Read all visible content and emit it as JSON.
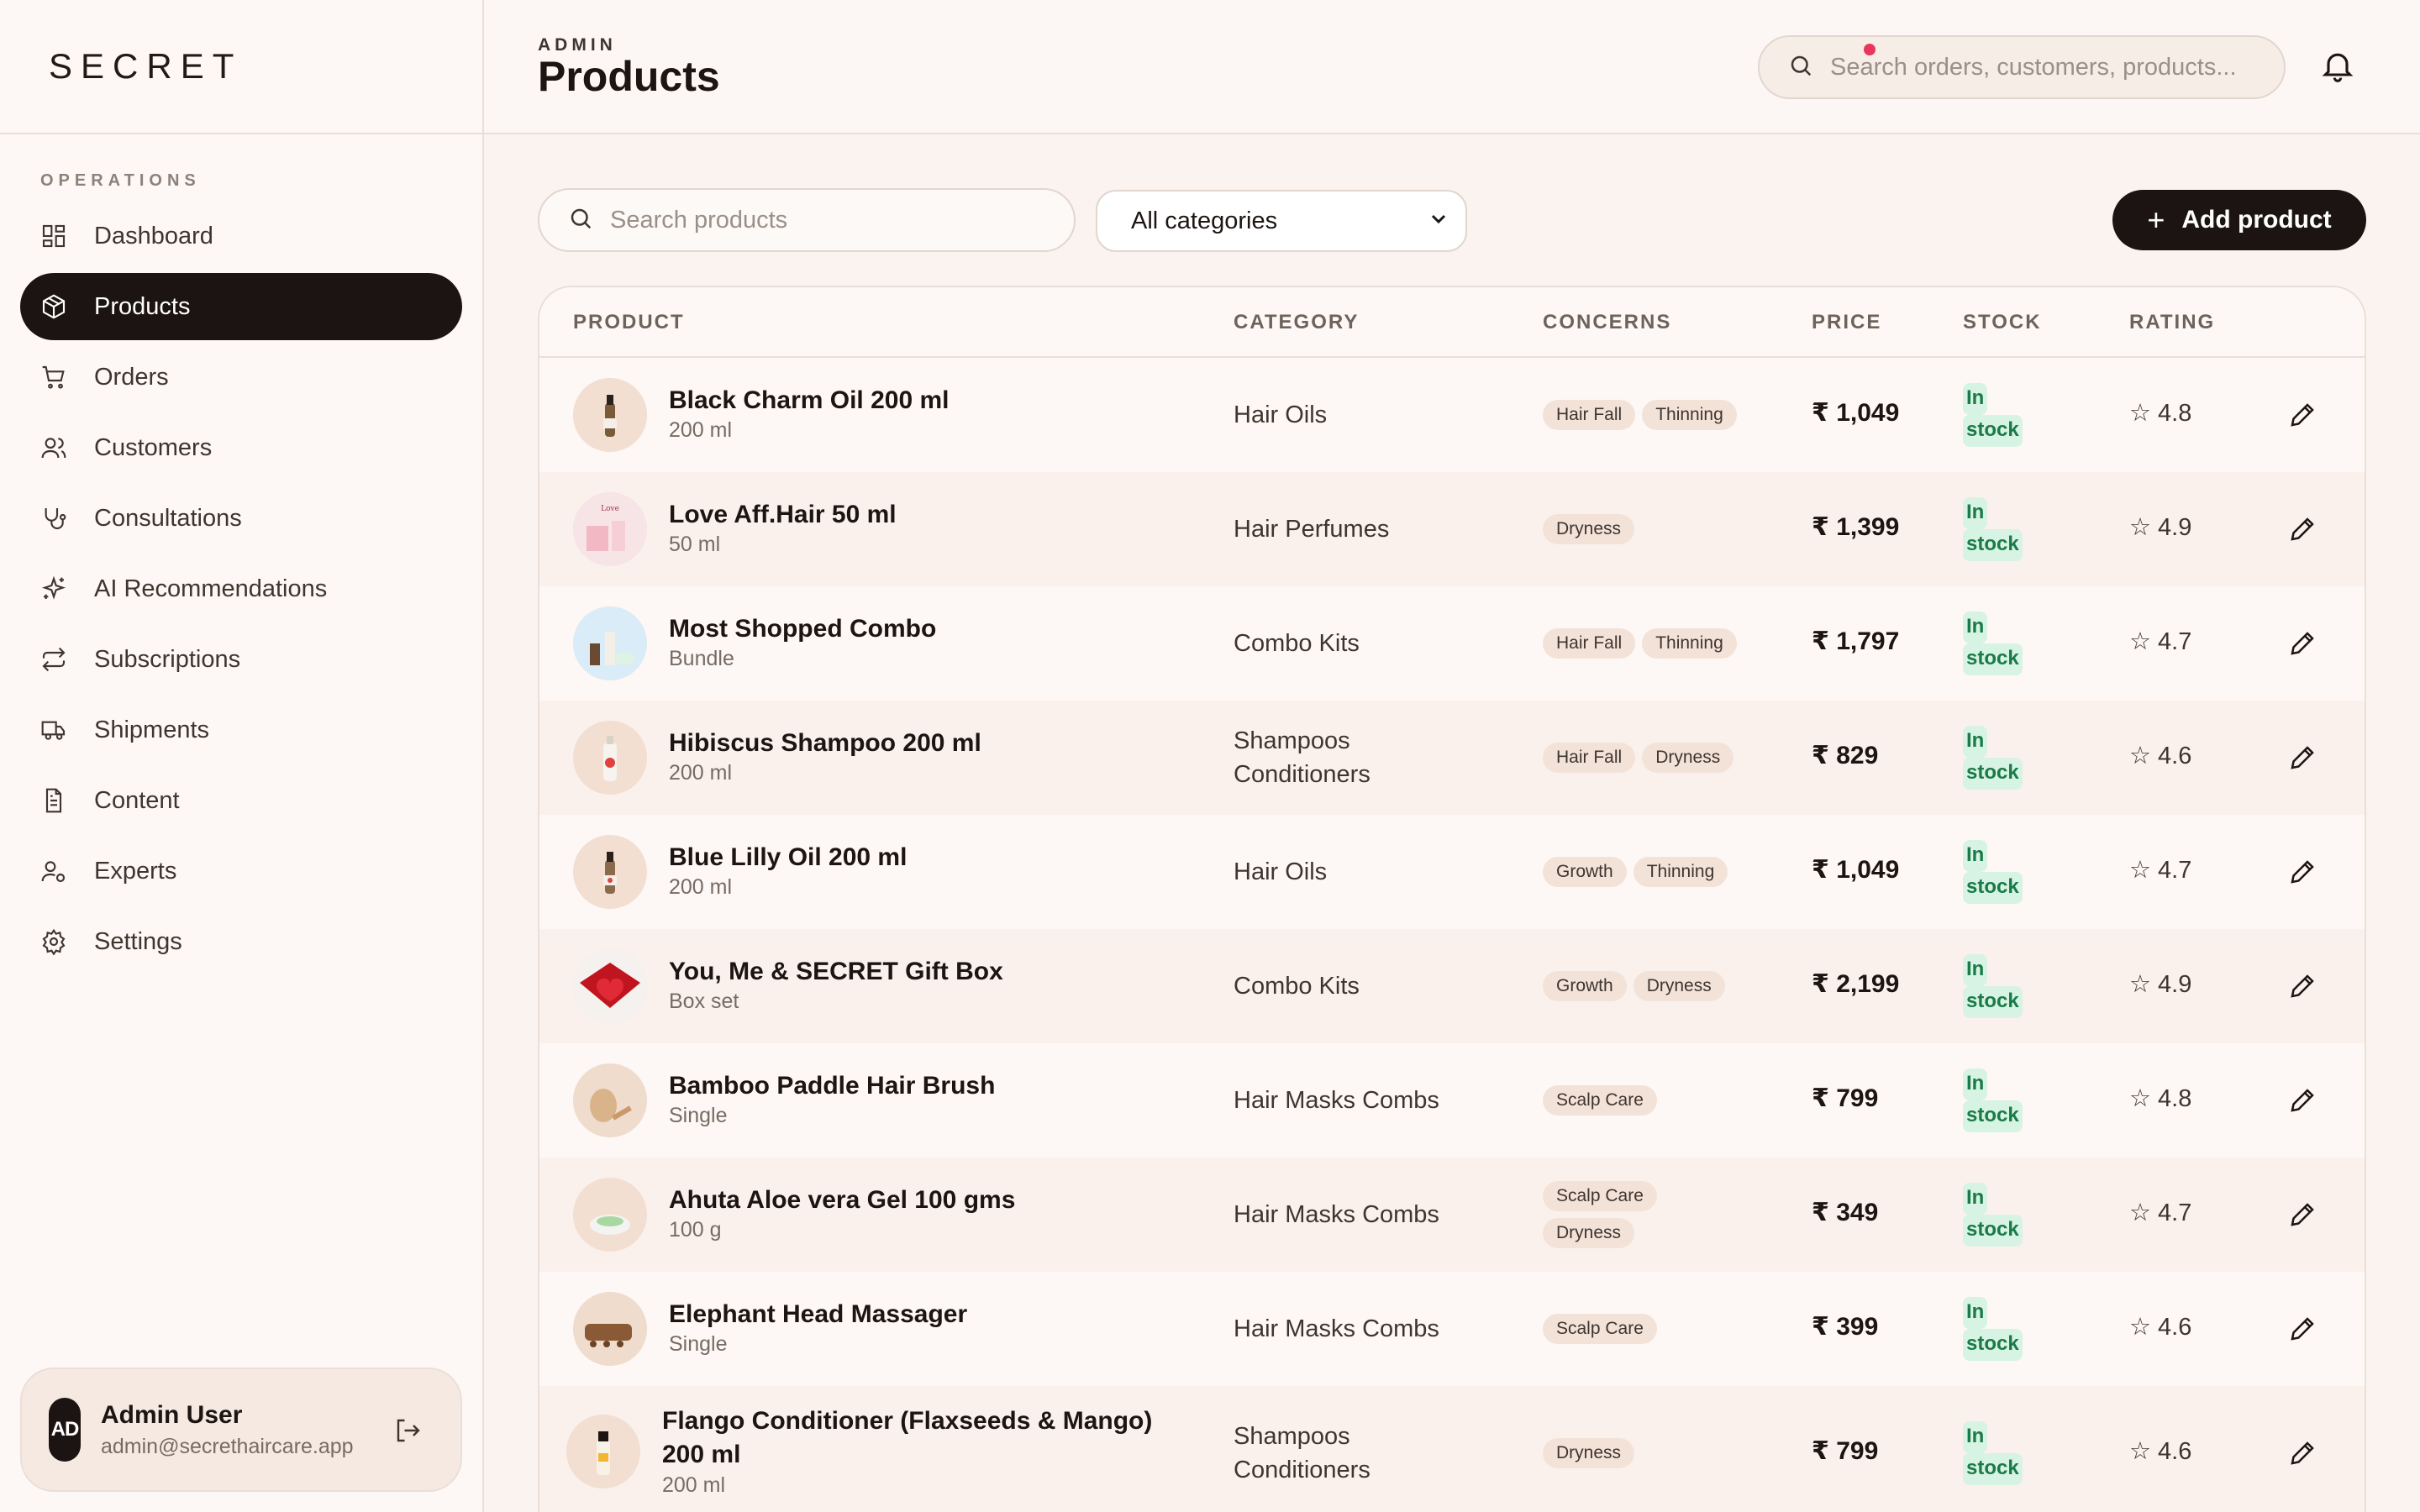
{
  "brand": "SECRET",
  "sidebar": {
    "section_label": "OPERATIONS",
    "items": [
      {
        "label": "Dashboard",
        "icon": "dashboard-icon"
      },
      {
        "label": "Products",
        "icon": "package-icon",
        "active": true
      },
      {
        "label": "Orders",
        "icon": "cart-icon"
      },
      {
        "label": "Customers",
        "icon": "users-icon"
      },
      {
        "label": "Consultations",
        "icon": "stethoscope-icon"
      },
      {
        "label": "AI Recommendations",
        "icon": "sparkles-icon"
      },
      {
        "label": "Subscriptions",
        "icon": "repeat-icon"
      },
      {
        "label": "Shipments",
        "icon": "truck-icon"
      },
      {
        "label": "Content",
        "icon": "file-icon"
      },
      {
        "label": "Experts",
        "icon": "user-cog-icon"
      },
      {
        "label": "Settings",
        "icon": "gear-icon"
      }
    ],
    "user": {
      "initials": "AD",
      "name": "Admin User",
      "email": "admin@secrethaircare.app"
    }
  },
  "header": {
    "eyebrow": "ADMIN",
    "title": "Products",
    "search_placeholder": "Search orders, customers, products..."
  },
  "toolbar": {
    "search_placeholder": "Search products",
    "category_value": "All categories",
    "add_label": "Add product"
  },
  "table": {
    "columns": [
      "PRODUCT",
      "CATEGORY",
      "CONCERNS",
      "PRICE",
      "STOCK",
      "RATING"
    ],
    "rows": [
      {
        "name": "Black Charm Oil 200 ml",
        "sub": "200 ml",
        "category": [
          "Hair Oils"
        ],
        "concerns": [
          "Hair Fall",
          "Thinning"
        ],
        "price": "₹ 1,049",
        "stock": [
          "In",
          "stock"
        ],
        "rating": "☆ 4.8"
      },
      {
        "name": "Love Aff.Hair 50 ml",
        "sub": "50 ml",
        "category": [
          "Hair Perfumes"
        ],
        "concerns": [
          "Dryness"
        ],
        "price": "₹ 1,399",
        "stock": [
          "In",
          "stock"
        ],
        "rating": "☆ 4.9"
      },
      {
        "name": "Most Shopped Combo",
        "sub": "Bundle",
        "category": [
          "Combo Kits"
        ],
        "concerns": [
          "Hair Fall",
          "Thinning"
        ],
        "price": "₹ 1,797",
        "stock": [
          "In",
          "stock"
        ],
        "rating": "☆ 4.7"
      },
      {
        "name": "Hibiscus Shampoo 200 ml",
        "sub": "200 ml",
        "category": [
          "Shampoos",
          "Conditioners"
        ],
        "concerns": [
          "Hair Fall",
          "Dryness"
        ],
        "price": "₹ 829",
        "stock": [
          "In",
          "stock"
        ],
        "rating": "☆ 4.6"
      },
      {
        "name": "Blue Lilly Oil 200 ml",
        "sub": "200 ml",
        "category": [
          "Hair Oils"
        ],
        "concerns": [
          "Growth",
          "Thinning"
        ],
        "price": "₹ 1,049",
        "stock": [
          "In",
          "stock"
        ],
        "rating": "☆ 4.7"
      },
      {
        "name": "You, Me & SECRET Gift Box",
        "sub": "Box set",
        "category": [
          "Combo Kits"
        ],
        "concerns": [
          "Growth",
          "Dryness"
        ],
        "price": "₹ 2,199",
        "stock": [
          "In",
          "stock"
        ],
        "rating": "☆ 4.9"
      },
      {
        "name": "Bamboo Paddle Hair Brush",
        "sub": "Single",
        "category": [
          "Hair Masks Combs"
        ],
        "concerns": [
          "Scalp Care"
        ],
        "price": "₹ 799",
        "stock": [
          "In",
          "stock"
        ],
        "rating": "☆ 4.8"
      },
      {
        "name": "Ahuta Aloe vera Gel 100 gms",
        "sub": "100 g",
        "category": [
          "Hair Masks Combs"
        ],
        "concerns": [
          "Scalp Care",
          "Dryness"
        ],
        "price": "₹ 349",
        "stock": [
          "In",
          "stock"
        ],
        "rating": "☆ 4.7"
      },
      {
        "name": "Elephant Head Massager",
        "sub": "Single",
        "category": [
          "Hair Masks Combs"
        ],
        "concerns": [
          "Scalp Care"
        ],
        "price": "₹ 399",
        "stock": [
          "In",
          "stock"
        ],
        "rating": "☆ 4.6"
      },
      {
        "name": "Flango Conditioner (Flaxseeds & Mango)",
        "name2": "200 ml",
        "sub": "200 ml",
        "category": [
          "Shampoos",
          "Conditioners"
        ],
        "concerns": [
          "Dryness"
        ],
        "price": "₹ 799",
        "stock": [
          "In",
          "stock"
        ],
        "rating": "☆ 4.6"
      }
    ]
  }
}
